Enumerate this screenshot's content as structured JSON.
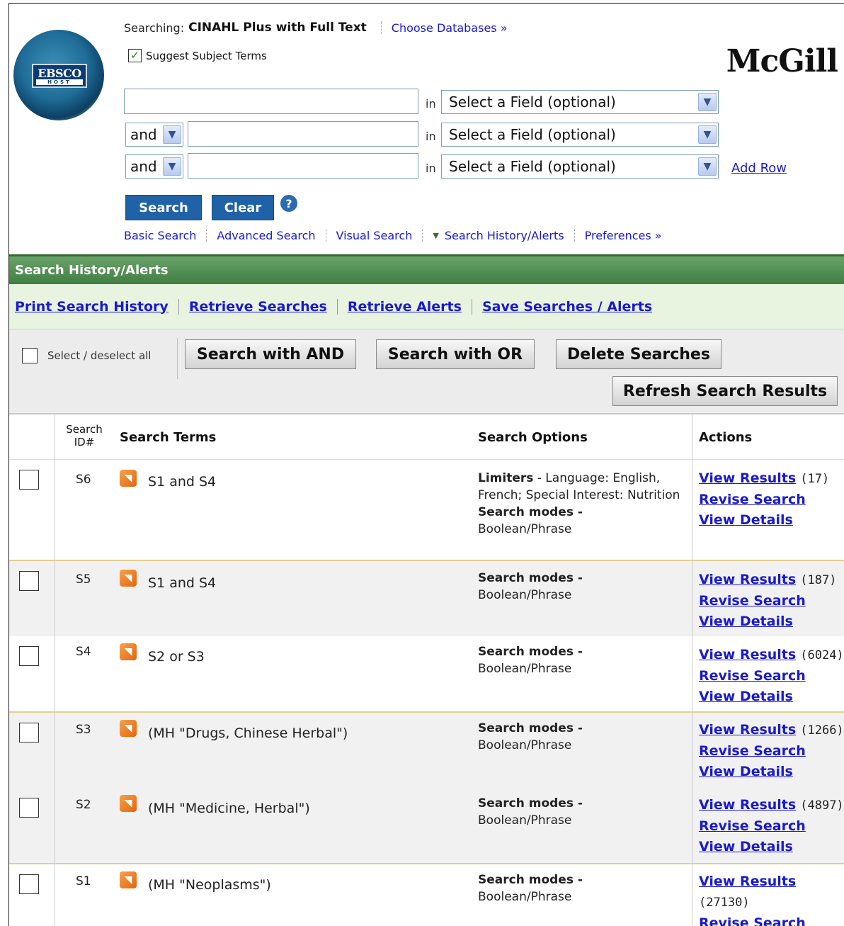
{
  "header": {
    "searching_label": "Searching:",
    "database": "CINAHL Plus with Full Text",
    "choose_databases": "Choose Databases »",
    "suggest_terms": "Suggest Subject Terms",
    "institution": "McGill",
    "logo_text": "EBSCO",
    "logo_subtext": "HOST"
  },
  "search_form": {
    "rows": [
      {
        "bool": "",
        "value": "",
        "in": "in",
        "field": "Select a Field (optional)"
      },
      {
        "bool": "and",
        "value": "",
        "in": "in",
        "field": "Select a Field (optional)"
      },
      {
        "bool": "and",
        "value": "",
        "in": "in",
        "field": "Select a Field (optional)"
      }
    ],
    "add_row": "Add Row",
    "search_btn": "Search",
    "clear_btn": "Clear",
    "help": "?"
  },
  "nav": {
    "basic": "Basic Search",
    "advanced": "Advanced Search",
    "visual": "Visual Search",
    "history": "Search History/Alerts",
    "preferences": "Preferences »"
  },
  "history": {
    "title": "Search History/Alerts",
    "links": [
      "Print Search History",
      "Retrieve Searches",
      "Retrieve Alerts",
      "Save Searches / Alerts"
    ],
    "select_all": "Select / deselect all",
    "btn_and": "Search with AND",
    "btn_or": "Search with OR",
    "btn_delete": "Delete Searches",
    "btn_refresh": "Refresh Search Results"
  },
  "table": {
    "headers": {
      "id_line1": "Search",
      "id_line2": "ID#",
      "terms": "Search Terms",
      "options": "Search Options",
      "actions": "Actions"
    },
    "rows": [
      {
        "id": "S6",
        "term": "S1 and S4",
        "limiters_label": "Limiters",
        "limiters": " - Language: English, French; Special Interest: Nutrition",
        "modes_label": "Search modes -",
        "modes": "Boolean/Phrase",
        "count": "(17)"
      },
      {
        "id": "S5",
        "term": "S1 and S4",
        "modes_label": "Search modes -",
        "modes": "Boolean/Phrase",
        "count": "(187)"
      },
      {
        "id": "S4",
        "term": "S2 or S3",
        "modes_label": "Search modes -",
        "modes": "Boolean/Phrase",
        "count": "(6024)"
      },
      {
        "id": "S3",
        "term": "(MH \"Drugs, Chinese Herbal\")",
        "modes_label": "Search modes -",
        "modes": "Boolean/Phrase",
        "count": "(1266)"
      },
      {
        "id": "S2",
        "term": "(MH \"Medicine, Herbal\")",
        "modes_label": "Search modes -",
        "modes": "Boolean/Phrase",
        "count": "(4897)"
      },
      {
        "id": "S1",
        "term": "(MH \"Neoplasms\")",
        "modes_label": "Search modes -",
        "modes": "Boolean/Phrase",
        "count": "(27130)"
      }
    ],
    "view_results": "View Results",
    "revise_search": "Revise Search",
    "view_details": "View Details"
  }
}
